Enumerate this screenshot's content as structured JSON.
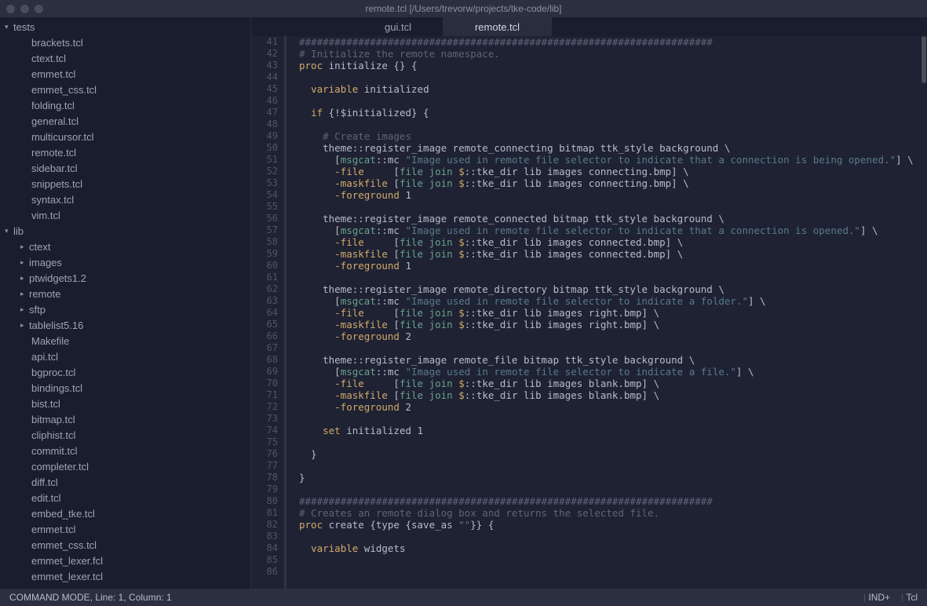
{
  "title": "remote.tcl [/Users/trevorw/projects/tke-code/lib]",
  "tabs": [
    {
      "label": "gui.tcl",
      "active": false
    },
    {
      "label": "remote.tcl",
      "active": true
    }
  ],
  "sidebar": {
    "groups": [
      {
        "label": "tests",
        "expanded": true,
        "items": [
          "brackets.tcl",
          "ctext.tcl",
          "emmet.tcl",
          "emmet_css.tcl",
          "folding.tcl",
          "general.tcl",
          "multicursor.tcl",
          "remote.tcl",
          "sidebar.tcl",
          "snippets.tcl",
          "syntax.tcl",
          "vim.tcl"
        ]
      },
      {
        "label": "lib",
        "expanded": true,
        "folders": [
          "ctext",
          "images",
          "ptwidgets1.2",
          "remote",
          "sftp",
          "tablelist5.16"
        ],
        "items": [
          "Makefile",
          "api.tcl",
          "bgproc.tcl",
          "bindings.tcl",
          "bist.tcl",
          "bitmap.tcl",
          "cliphist.tcl",
          "commit.tcl",
          "completer.tcl",
          "diff.tcl",
          "edit.tcl",
          "embed_tke.tcl",
          "emmet.tcl",
          "emmet_css.tcl",
          "emmet_lexer.fcl",
          "emmet_lexer.tcl"
        ]
      }
    ]
  },
  "gutter": {
    "start": 41,
    "end": 86
  },
  "code": {
    "lines": [
      {
        "t": "cmt",
        "c": "######################################################################"
      },
      {
        "t": "cmt",
        "c": "# Initialize the remote namespace."
      },
      {
        "t": "raw",
        "c": "<span class='kw'>proc</span> initialize {} {"
      },
      {
        "t": "raw",
        "c": ""
      },
      {
        "t": "raw",
        "c": "  <span class='kw'>variable</span> initialized"
      },
      {
        "t": "raw",
        "c": ""
      },
      {
        "t": "raw",
        "c": "  <span class='kw'>if</span> {!$initialized} {"
      },
      {
        "t": "raw",
        "c": ""
      },
      {
        "t": "cmt",
        "c": "    # Create images"
      },
      {
        "t": "raw",
        "c": "    theme::register_image remote_connecting bitmap ttk_style background \\"
      },
      {
        "t": "raw",
        "c": "      [<span class='kw2'>msgcat</span>::mc <span class='str'>\"Image used in remote file selector to indicate that a connection is being opened.\"</span>] \\"
      },
      {
        "t": "raw",
        "c": "      <span class='flag'>-file</span>     [<span class='kw2'>file</span> <span class='kw2'>join</span> <span class='var'>$</span>::tke_dir lib images connecting.bmp] \\"
      },
      {
        "t": "raw",
        "c": "      <span class='flag'>-maskfile</span> [<span class='kw2'>file</span> <span class='kw2'>join</span> <span class='var'>$</span>::tke_dir lib images connecting.bmp] \\"
      },
      {
        "t": "raw",
        "c": "      <span class='flag'>-foreground</span> 1"
      },
      {
        "t": "raw",
        "c": ""
      },
      {
        "t": "raw",
        "c": "    theme::register_image remote_connected bitmap ttk_style background \\"
      },
      {
        "t": "raw",
        "c": "      [<span class='kw2'>msgcat</span>::mc <span class='str'>\"Image used in remote file selector to indicate that a connection is opened.\"</span>] \\"
      },
      {
        "t": "raw",
        "c": "      <span class='flag'>-file</span>     [<span class='kw2'>file</span> <span class='kw2'>join</span> <span class='var'>$</span>::tke_dir lib images connected.bmp] \\"
      },
      {
        "t": "raw",
        "c": "      <span class='flag'>-maskfile</span> [<span class='kw2'>file</span> <span class='kw2'>join</span> <span class='var'>$</span>::tke_dir lib images connected.bmp] \\"
      },
      {
        "t": "raw",
        "c": "      <span class='flag'>-foreground</span> 1"
      },
      {
        "t": "raw",
        "c": ""
      },
      {
        "t": "raw",
        "c": "    theme::register_image remote_directory bitmap ttk_style background \\"
      },
      {
        "t": "raw",
        "c": "      [<span class='kw2'>msgcat</span>::mc <span class='str'>\"Image used in remote file selector to indicate a folder.\"</span>] \\"
      },
      {
        "t": "raw",
        "c": "      <span class='flag'>-file</span>     [<span class='kw2'>file</span> <span class='kw2'>join</span> <span class='var'>$</span>::tke_dir lib images right.bmp] \\"
      },
      {
        "t": "raw",
        "c": "      <span class='flag'>-maskfile</span> [<span class='kw2'>file</span> <span class='kw2'>join</span> <span class='var'>$</span>::tke_dir lib images right.bmp] \\"
      },
      {
        "t": "raw",
        "c": "      <span class='flag'>-foreground</span> 2"
      },
      {
        "t": "raw",
        "c": ""
      },
      {
        "t": "raw",
        "c": "    theme::register_image remote_file bitmap ttk_style background \\"
      },
      {
        "t": "raw",
        "c": "      [<span class='kw2'>msgcat</span>::mc <span class='str'>\"Image used in remote file selector to indicate a file.\"</span>] \\"
      },
      {
        "t": "raw",
        "c": "      <span class='flag'>-file</span>     [<span class='kw2'>file</span> <span class='kw2'>join</span> <span class='var'>$</span>::tke_dir lib images blank.bmp] \\"
      },
      {
        "t": "raw",
        "c": "      <span class='flag'>-maskfile</span> [<span class='kw2'>file</span> <span class='kw2'>join</span> <span class='var'>$</span>::tke_dir lib images blank.bmp] \\"
      },
      {
        "t": "raw",
        "c": "      <span class='flag'>-foreground</span> 2"
      },
      {
        "t": "raw",
        "c": ""
      },
      {
        "t": "raw",
        "c": "    <span class='kw'>set</span> initialized 1"
      },
      {
        "t": "raw",
        "c": ""
      },
      {
        "t": "raw",
        "c": "  }"
      },
      {
        "t": "raw",
        "c": ""
      },
      {
        "t": "raw",
        "c": "}"
      },
      {
        "t": "raw",
        "c": ""
      },
      {
        "t": "cmt",
        "c": "######################################################################"
      },
      {
        "t": "cmt",
        "c": "# Creates an remote dialog box and returns the selected file."
      },
      {
        "t": "raw",
        "c": "<span class='kw'>proc</span> create {type {save_as <span class='str'>\"\"</span>}} {"
      },
      {
        "t": "raw",
        "c": ""
      },
      {
        "t": "raw",
        "c": "  <span class='kw'>variable</span> widgets"
      },
      {
        "t": "raw",
        "c": ""
      }
    ]
  },
  "status": {
    "left": "COMMAND MODE, Line: 1, Column: 1",
    "right": [
      "IND+",
      "Tcl"
    ]
  }
}
